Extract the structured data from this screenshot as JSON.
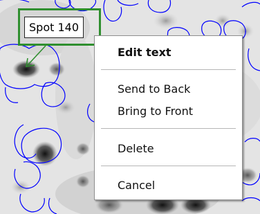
{
  "spot_label": {
    "text": "Spot 140"
  },
  "context_menu": {
    "items": [
      {
        "label": "Edit text",
        "bold": true
      },
      {
        "label": "Send to Back",
        "bold": false
      },
      {
        "label": "Bring to Front",
        "bold": false
      },
      {
        "label": "Delete",
        "bold": false
      },
      {
        "label": "Cancel",
        "bold": false
      }
    ]
  },
  "colors": {
    "spot_outline": "#0000ff",
    "label_frame": "#2f8f2f",
    "arrow": "#2f8f2f",
    "gel_background": "#e3e3e3"
  }
}
